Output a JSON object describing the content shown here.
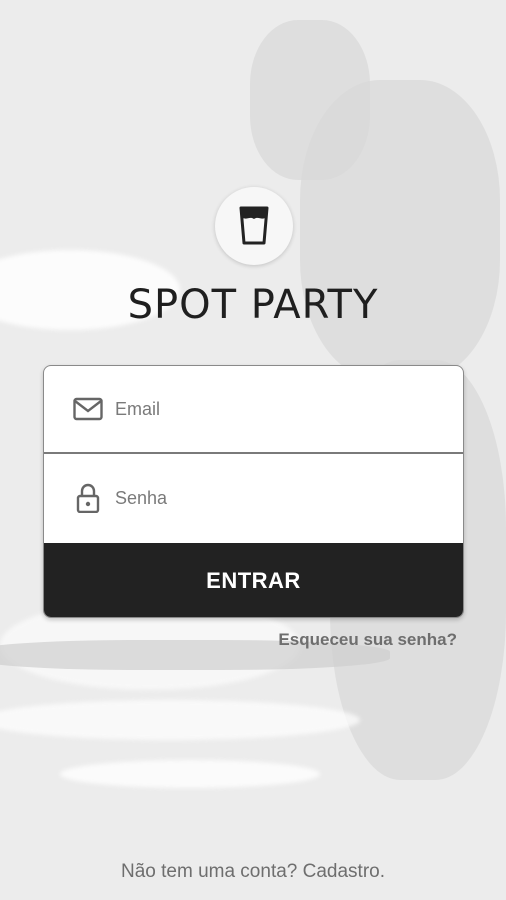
{
  "app": {
    "title": "SPOT PARTY"
  },
  "login": {
    "email_placeholder": "Email",
    "password_placeholder": "Senha",
    "submit_label": "ENTRAR",
    "forgot_label": "Esqueceu sua senha?"
  },
  "footer": {
    "signup_label": "Não tem uma conta? Cadastro."
  },
  "icons": {
    "logo": "cup-icon",
    "email": "mail-icon",
    "password": "lock-icon"
  },
  "colors": {
    "button": "#222222",
    "text_muted": "#6e6e6e",
    "title": "#1f1f1f"
  }
}
